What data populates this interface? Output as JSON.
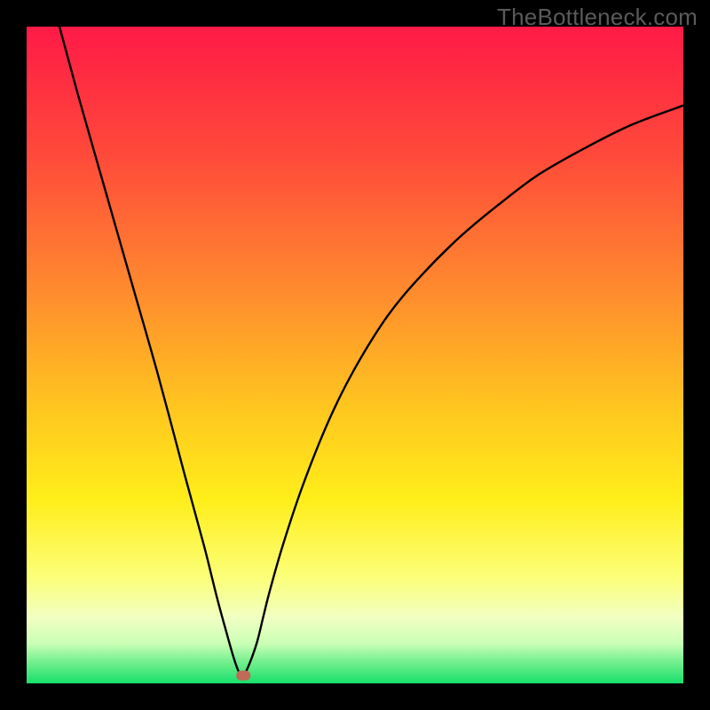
{
  "watermark": "TheBottleneck.com",
  "chart_data": {
    "type": "line",
    "title": "",
    "xlabel": "",
    "ylabel": "",
    "xlim": [
      0,
      100
    ],
    "ylim": [
      0,
      100
    ],
    "grid": false,
    "legend": false,
    "annotations": [],
    "background_gradient_stops": [
      {
        "pos": 0.0,
        "color": "#ff1a46"
      },
      {
        "pos": 0.2,
        "color": "#ff4b3a"
      },
      {
        "pos": 0.4,
        "color": "#ff8a2e"
      },
      {
        "pos": 0.58,
        "color": "#ffc61f"
      },
      {
        "pos": 0.72,
        "color": "#ffee1a"
      },
      {
        "pos": 0.84,
        "color": "#fcff7a"
      },
      {
        "pos": 0.9,
        "color": "#f1ffc2"
      },
      {
        "pos": 0.94,
        "color": "#c9ffb6"
      },
      {
        "pos": 0.965,
        "color": "#7af091"
      },
      {
        "pos": 1.0,
        "color": "#18e06a"
      }
    ],
    "series": [
      {
        "name": "bottleneck-curve",
        "color": "#000000",
        "x": [
          5,
          8,
          12,
          16,
          20,
          24,
          27,
          29,
          30.5,
          31.5,
          32.2,
          32.8,
          33.5,
          35,
          36,
          37,
          39,
          42,
          46,
          50,
          55,
          60,
          66,
          72,
          78,
          85,
          92,
          100
        ],
        "y": [
          100,
          89,
          75,
          61,
          47,
          32,
          21,
          13,
          7.5,
          4,
          2,
          1.2,
          2,
          6,
          10,
          14,
          21,
          30,
          40,
          48,
          56,
          62,
          68,
          73,
          77.5,
          81.5,
          85,
          88
        ]
      }
    ],
    "marker": {
      "name": "optimum-marker",
      "x": 33,
      "y": 1.2,
      "color": "#c06a58"
    }
  }
}
